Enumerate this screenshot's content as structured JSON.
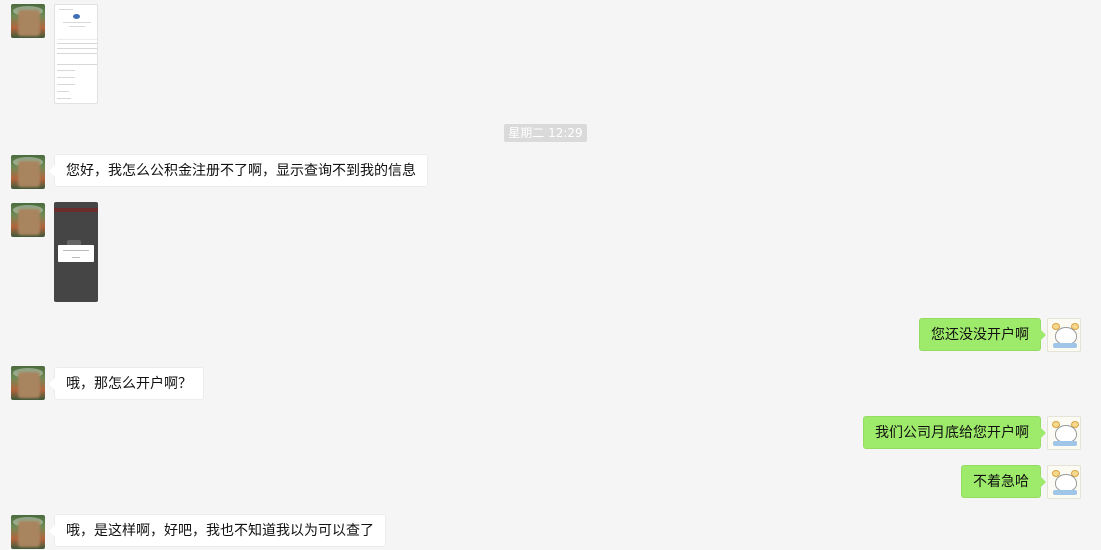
{
  "timestamp": "星期二 12:29",
  "messages": [
    {
      "side": "left",
      "type": "image",
      "desc": "screenshot-light"
    },
    {
      "side": "left",
      "type": "text",
      "text": "您好，我怎么公积金注册不了啊，显示查询不到我的信息"
    },
    {
      "side": "left",
      "type": "image",
      "desc": "screenshot-dark"
    },
    {
      "side": "right",
      "type": "text",
      "text": "您还没没开户啊"
    },
    {
      "side": "left",
      "type": "text",
      "text": "哦，那怎么开户啊？"
    },
    {
      "side": "right",
      "type": "text",
      "text": "我们公司月底给您开户啊"
    },
    {
      "side": "right",
      "type": "text",
      "text": "不着急哈"
    },
    {
      "side": "left",
      "type": "text",
      "text": "哦，是这样啊，好吧，我也不知道我以为可以查了"
    }
  ],
  "colors": {
    "background": "#f5f5f5",
    "bubble_left": "#ffffff",
    "bubble_right": "#9eea6a",
    "timestamp_bg": "#dadada"
  },
  "icons": {
    "left_avatar": "blurred-person-avatar",
    "right_avatar": "cartoon-sheep-avatar"
  }
}
